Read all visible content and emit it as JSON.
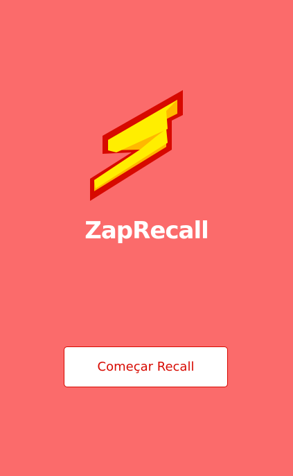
{
  "app": {
    "title": "ZapRecall",
    "logo_icon": "lightning-bolt-icon"
  },
  "actions": {
    "start_label": "Começar Recall"
  },
  "colors": {
    "background": "#FB6B6B",
    "title": "#FFFFFF",
    "button_background": "#FFFFFF",
    "button_text": "#D70900",
    "button_border": "#D70900",
    "bolt_outline": "#D70900",
    "bolt_face": "#FFEE00",
    "bolt_side": "#FFB800"
  }
}
